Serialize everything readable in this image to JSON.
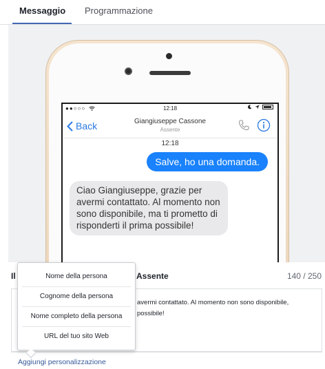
{
  "tabs": [
    {
      "label": "Messaggio",
      "active": true
    },
    {
      "label": "Programmazione",
      "active": false
    }
  ],
  "phone": {
    "status_bar": {
      "signal": "●●○○○",
      "time": "12:18"
    },
    "nav": {
      "back_label": "Back",
      "contact_name": "Giangiuseppe Cassone",
      "contact_status": "Assente"
    },
    "timestamp": "12:18",
    "outgoing_message": "Salve, ho una domanda.",
    "incoming_message": "Ciao Giangiuseppe, grazie per avermi contattato. Al momento non sono disponibile, ma ti prometto di risponderti il prima possibile!"
  },
  "editor": {
    "title_partial": "Il",
    "title": "Assente",
    "counter": "140 / 250",
    "text_line1": "avermi contattato. Al momento non sono disponibile,",
    "text_line2": "possibile!",
    "add_personalization": "Aggiungi personalizzazione"
  },
  "personalization_menu": {
    "items": [
      "Nome della persona",
      "Cognome della persona",
      "Nome completo della persona",
      "URL del tuo sito Web"
    ]
  },
  "colors": {
    "accent": "#4267b2",
    "ios_blue": "#1982fc",
    "link": "#365899",
    "incoming_bubble": "#e9e9eb",
    "phone_gold": "#ecd5ba"
  }
}
